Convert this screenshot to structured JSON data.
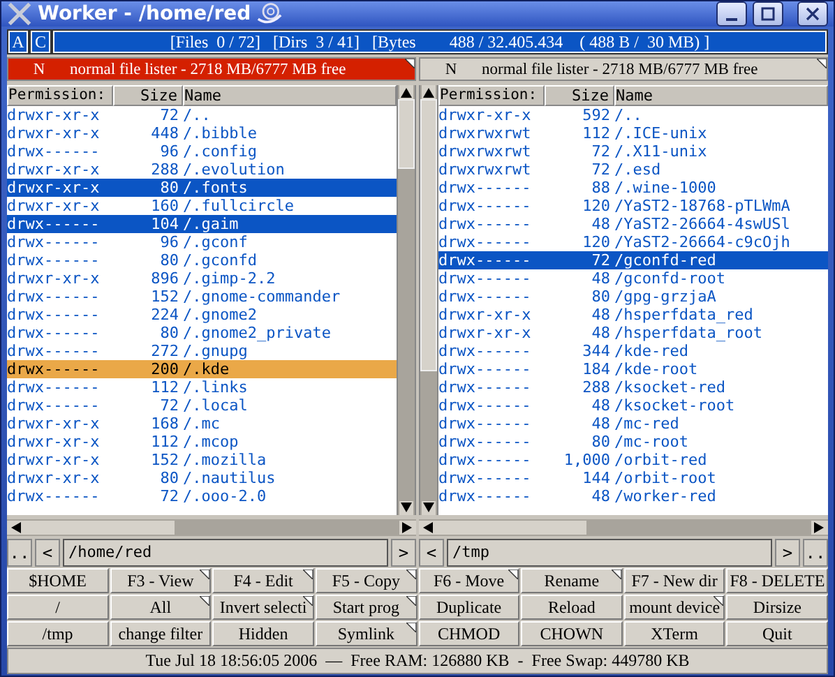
{
  "window": {
    "title": "Worker - /home/red"
  },
  "mode_buttons": [
    "A",
    "C"
  ],
  "info_bar": "[Files  0 / 72]   [Dirs  3 / 41]   [Bytes        488 / 32.405.434    ( 488 B /  30 MB) ]",
  "panels": [
    {
      "active": true,
      "lister_mode": "N",
      "lister_title": "normal file lister - 2718 MB/6777 MB free",
      "columns": [
        "Permission:",
        "Size",
        "Name"
      ],
      "path": "/home/red",
      "nav": [
        "..",
        "<",
        ">"
      ],
      "rows": [
        {
          "perm": "drwxr-xr-x",
          "size": "72",
          "name": "/..",
          "selected": false,
          "cursor": false
        },
        {
          "perm": "drwxr-xr-x",
          "size": "448",
          "name": "/.bibble",
          "selected": false,
          "cursor": false
        },
        {
          "perm": "drwx------",
          "size": "96",
          "name": "/.config",
          "selected": false,
          "cursor": false
        },
        {
          "perm": "drwxr-xr-x",
          "size": "288",
          "name": "/.evolution",
          "selected": false,
          "cursor": false
        },
        {
          "perm": "drwxr-xr-x",
          "size": "80",
          "name": "/.fonts",
          "selected": true,
          "cursor": false
        },
        {
          "perm": "drwxr-xr-x",
          "size": "160",
          "name": "/.fullcircle",
          "selected": false,
          "cursor": false
        },
        {
          "perm": "drwx------",
          "size": "104",
          "name": "/.gaim",
          "selected": true,
          "cursor": false
        },
        {
          "perm": "drwx------",
          "size": "96",
          "name": "/.gconf",
          "selected": false,
          "cursor": false
        },
        {
          "perm": "drwx------",
          "size": "80",
          "name": "/.gconfd",
          "selected": false,
          "cursor": false
        },
        {
          "perm": "drwxr-xr-x",
          "size": "896",
          "name": "/.gimp-2.2",
          "selected": false,
          "cursor": false
        },
        {
          "perm": "drwx------",
          "size": "152",
          "name": "/.gnome-commander",
          "selected": false,
          "cursor": false
        },
        {
          "perm": "drwx------",
          "size": "224",
          "name": "/.gnome2",
          "selected": false,
          "cursor": false
        },
        {
          "perm": "drwx------",
          "size": "80",
          "name": "/.gnome2_private",
          "selected": false,
          "cursor": false
        },
        {
          "perm": "drwx------",
          "size": "272",
          "name": "/.gnupg",
          "selected": false,
          "cursor": false
        },
        {
          "perm": "drwx------",
          "size": "200",
          "name": "/.kde",
          "selected": false,
          "cursor": true
        },
        {
          "perm": "drwx------",
          "size": "112",
          "name": "/.links",
          "selected": false,
          "cursor": false
        },
        {
          "perm": "drwx------",
          "size": "72",
          "name": "/.local",
          "selected": false,
          "cursor": false
        },
        {
          "perm": "drwxr-xr-x",
          "size": "168",
          "name": "/.mc",
          "selected": false,
          "cursor": false
        },
        {
          "perm": "drwxr-xr-x",
          "size": "112",
          "name": "/.mcop",
          "selected": false,
          "cursor": false
        },
        {
          "perm": "drwxr-xr-x",
          "size": "152",
          "name": "/.mozilla",
          "selected": false,
          "cursor": false
        },
        {
          "perm": "drwxr-xr-x",
          "size": "80",
          "name": "/.nautilus",
          "selected": false,
          "cursor": false
        },
        {
          "perm": "drwx------",
          "size": "72",
          "name": "/.ooo-2.0",
          "selected": false,
          "cursor": false
        }
      ]
    },
    {
      "active": false,
      "lister_mode": "N",
      "lister_title": "normal file lister - 2718 MB/6777 MB free",
      "columns": [
        "Permission:",
        "Size",
        "Name"
      ],
      "path": "/tmp",
      "nav": [
        "<",
        ">",
        ".."
      ],
      "rows": [
        {
          "perm": "drwxr-xr-x",
          "size": "592",
          "name": "/..",
          "selected": false,
          "cursor": false
        },
        {
          "perm": "drwxrwxrwt",
          "size": "112",
          "name": "/.ICE-unix",
          "selected": false,
          "cursor": false
        },
        {
          "perm": "drwxrwxrwt",
          "size": "72",
          "name": "/.X11-unix",
          "selected": false,
          "cursor": false
        },
        {
          "perm": "drwxrwxrwt",
          "size": "72",
          "name": "/.esd",
          "selected": false,
          "cursor": false
        },
        {
          "perm": "drwx------",
          "size": "88",
          "name": "/.wine-1000",
          "selected": false,
          "cursor": false
        },
        {
          "perm": "drwx------",
          "size": "120",
          "name": "/YaST2-18768-pTLWmA",
          "selected": false,
          "cursor": false
        },
        {
          "perm": "drwx------",
          "size": "48",
          "name": "/YaST2-26664-4swUSl",
          "selected": false,
          "cursor": false
        },
        {
          "perm": "drwx------",
          "size": "120",
          "name": "/YaST2-26664-c9cOjh",
          "selected": false,
          "cursor": false
        },
        {
          "perm": "drwx------",
          "size": "72",
          "name": "/gconfd-red",
          "selected": true,
          "cursor": false
        },
        {
          "perm": "drwx------",
          "size": "48",
          "name": "/gconfd-root",
          "selected": false,
          "cursor": false
        },
        {
          "perm": "drwx------",
          "size": "80",
          "name": "/gpg-grzjaA",
          "selected": false,
          "cursor": false
        },
        {
          "perm": "drwxr-xr-x",
          "size": "48",
          "name": "/hsperfdata_red",
          "selected": false,
          "cursor": false
        },
        {
          "perm": "drwxr-xr-x",
          "size": "48",
          "name": "/hsperfdata_root",
          "selected": false,
          "cursor": false
        },
        {
          "perm": "drwx------",
          "size": "344",
          "name": "/kde-red",
          "selected": false,
          "cursor": false
        },
        {
          "perm": "drwx------",
          "size": "184",
          "name": "/kde-root",
          "selected": false,
          "cursor": false
        },
        {
          "perm": "drwx------",
          "size": "288",
          "name": "/ksocket-red",
          "selected": false,
          "cursor": false
        },
        {
          "perm": "drwx------",
          "size": "48",
          "name": "/ksocket-root",
          "selected": false,
          "cursor": false
        },
        {
          "perm": "drwx------",
          "size": "48",
          "name": "/mc-red",
          "selected": false,
          "cursor": false
        },
        {
          "perm": "drwx------",
          "size": "80",
          "name": "/mc-root",
          "selected": false,
          "cursor": false
        },
        {
          "perm": "drwx------",
          "size": "1,000",
          "name": "/orbit-red",
          "selected": false,
          "cursor": false
        },
        {
          "perm": "drwx------",
          "size": "144",
          "name": "/orbit-root",
          "selected": false,
          "cursor": false
        },
        {
          "perm": "drwx------",
          "size": "48",
          "name": "/worker-red",
          "selected": false,
          "cursor": false
        }
      ]
    }
  ],
  "buttons": [
    {
      "label": "$HOME",
      "corner": false
    },
    {
      "label": "F3 - View",
      "corner": true
    },
    {
      "label": "F4 - Edit",
      "corner": true
    },
    {
      "label": "F5 - Copy",
      "corner": true
    },
    {
      "label": "F6 - Move",
      "corner": true
    },
    {
      "label": "Rename",
      "corner": true
    },
    {
      "label": "F7 - New dir",
      "corner": false
    },
    {
      "label": "F8 - DELETE",
      "corner": false
    },
    {
      "label": "/",
      "corner": false
    },
    {
      "label": "All",
      "corner": true
    },
    {
      "label": "Invert selecti",
      "corner": true
    },
    {
      "label": "Start prog",
      "corner": true
    },
    {
      "label": "Duplicate",
      "corner": false
    },
    {
      "label": "Reload",
      "corner": false
    },
    {
      "label": "mount device",
      "corner": true
    },
    {
      "label": "Dirsize",
      "corner": false
    },
    {
      "label": "/tmp",
      "corner": false
    },
    {
      "label": "change filter",
      "corner": false
    },
    {
      "label": "Hidden",
      "corner": false
    },
    {
      "label": "Symlink",
      "corner": true
    },
    {
      "label": "CHMOD",
      "corner": false
    },
    {
      "label": "CHOWN",
      "corner": false
    },
    {
      "label": "XTerm",
      "corner": false
    },
    {
      "label": "Quit",
      "corner": false
    }
  ],
  "status_bar": "Tue Jul 18 18:56:05 2006  —  Free RAM: 126880 KB  -  Free Swap: 449780 KB"
}
